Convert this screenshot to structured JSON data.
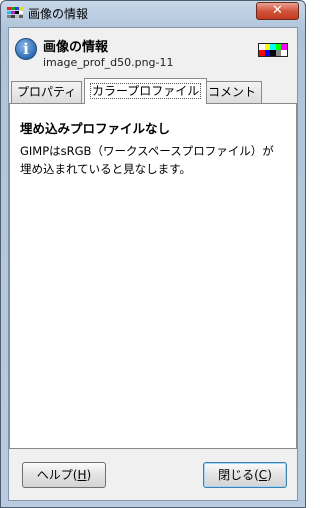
{
  "window": {
    "title": "画像の情報",
    "close_symbol": "✕"
  },
  "header": {
    "icon": "info-icon",
    "icon_glyph": "i",
    "title": "画像の情報",
    "subtitle": "image_prof_d50.png-11"
  },
  "tabs": [
    {
      "label": "プロパティ",
      "active": false
    },
    {
      "label": "カラープロファイル",
      "active": true
    },
    {
      "label": "コメント",
      "active": false
    }
  ],
  "panel": {
    "heading": "埋め込みプロファイルなし",
    "line1": "GIMPはsRGB（ワークスペースプロファイル）が",
    "line2": "埋め込まれていると見なします。"
  },
  "buttons": {
    "help_prefix": "ヘルプ(",
    "help_key": "H",
    "help_suffix": ")",
    "close_prefix": "閉じる(",
    "close_key": "C",
    "close_suffix": ")"
  },
  "colors": {
    "close_button": "#d2543b",
    "accent_focus": "#3c7fb1"
  }
}
